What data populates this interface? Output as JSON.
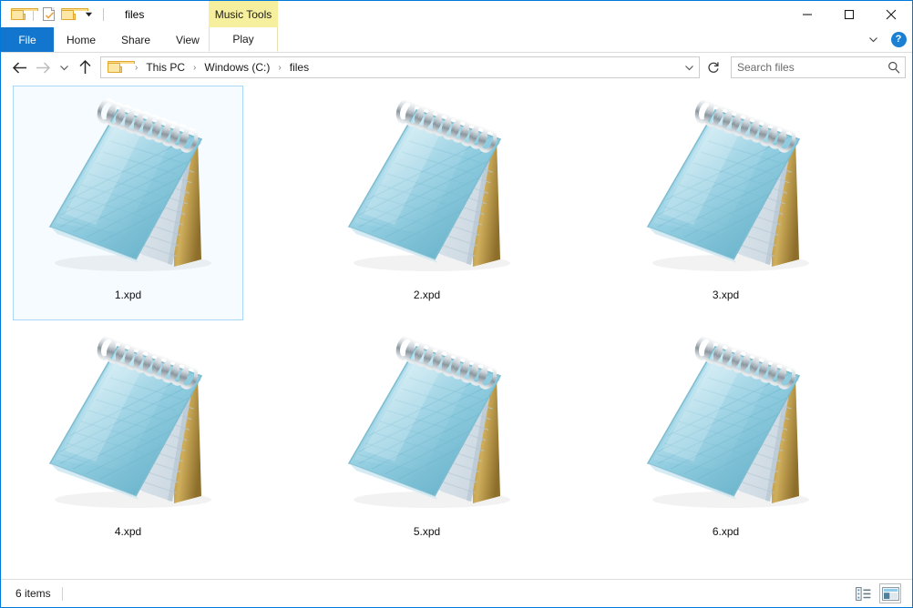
{
  "window": {
    "title": "files",
    "contextual_tools_label": "Music Tools",
    "border_color": "#0078d7"
  },
  "quick_access_toolbar": {
    "items": [
      {
        "name": "new-folder-icon",
        "tooltip": "New folder"
      },
      {
        "name": "properties-icon",
        "tooltip": "Properties"
      },
      {
        "name": "folder-icon",
        "tooltip": "Folder"
      },
      {
        "name": "customize-dropdown-icon",
        "tooltip": "Customize Quick Access Toolbar"
      }
    ]
  },
  "window_controls": {
    "minimize": "–",
    "maximize": "☐",
    "close": "✕"
  },
  "ribbon": {
    "tabs": [
      {
        "label": "File",
        "active_file": true
      },
      {
        "label": "Home",
        "active_file": false
      },
      {
        "label": "Share",
        "active_file": false
      },
      {
        "label": "View",
        "active_file": false
      }
    ],
    "contextual_tab": {
      "label": "Play",
      "selected": true
    },
    "expand_label": "∨",
    "help_label": "?",
    "file_tab_color": "#1276ce",
    "contextual_header_color": "#f6ef9e"
  },
  "navigation": {
    "back": "←",
    "forward": "→",
    "recent": "∨",
    "up": "↑",
    "breadcrumb": [
      "This PC",
      "Windows (C:)",
      "files"
    ],
    "breadcrumb_separator": "›",
    "dropdown": "∨",
    "refresh": "↻"
  },
  "search": {
    "placeholder": "Search files",
    "value": "",
    "icon": "search-icon"
  },
  "files": [
    {
      "name": "1.xpd",
      "icon": "notepad-icon",
      "selected": true
    },
    {
      "name": "2.xpd",
      "icon": "notepad-icon",
      "selected": false
    },
    {
      "name": "3.xpd",
      "icon": "notepad-icon",
      "selected": false
    },
    {
      "name": "4.xpd",
      "icon": "notepad-icon",
      "selected": false
    },
    {
      "name": "5.xpd",
      "icon": "notepad-icon",
      "selected": false
    },
    {
      "name": "6.xpd",
      "icon": "notepad-icon",
      "selected": false
    }
  ],
  "status": {
    "item_count": "6 items",
    "view_details_icon": "details-view-icon",
    "view_large_icons_icon": "large-icons-view-icon",
    "active_view": "large-icons"
  }
}
